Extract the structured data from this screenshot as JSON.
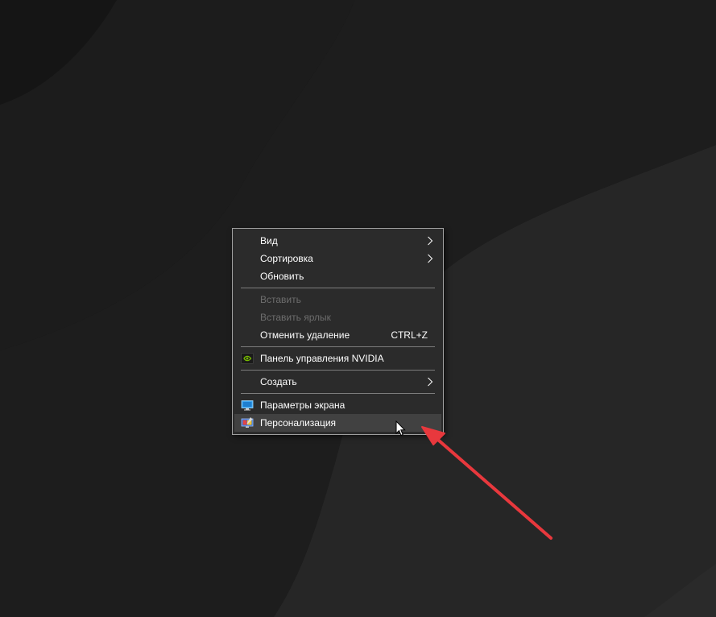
{
  "desktop": {
    "background_colors": {
      "dark": "#151515",
      "mid": "#1f1f1f",
      "light": "#262626"
    }
  },
  "context_menu": {
    "items": [
      {
        "label": "Вид",
        "submenu": true,
        "disabled": false
      },
      {
        "label": "Сортировка",
        "submenu": true,
        "disabled": false
      },
      {
        "label": "Обновить",
        "disabled": false
      },
      {
        "label": "Вставить",
        "disabled": true
      },
      {
        "label": "Вставить ярлык",
        "disabled": true
      },
      {
        "label": "Отменить удаление",
        "shortcut": "CTRL+Z",
        "disabled": false
      },
      {
        "label": "Панель управления NVIDIA",
        "icon": "nvidia-icon",
        "disabled": false
      },
      {
        "label": "Создать",
        "submenu": true,
        "disabled": false
      },
      {
        "label": "Параметры экрана",
        "icon": "display-settings-icon",
        "disabled": false
      },
      {
        "label": "Персонализация",
        "icon": "personalization-icon",
        "disabled": false,
        "hovered": true
      }
    ],
    "colors": {
      "background": "#2b2b2b",
      "border": "#a0a0a0",
      "text": "#ffffff",
      "disabled_text": "#6d6d6d",
      "hover": "#414141"
    }
  },
  "annotation": {
    "arrow_color": "#e8383d",
    "points_to": "Персонализация"
  }
}
